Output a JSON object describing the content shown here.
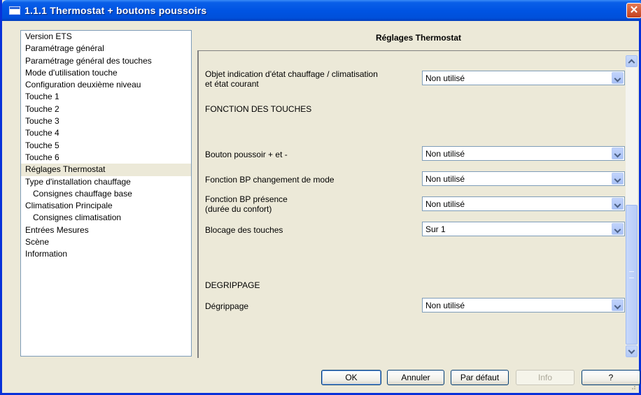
{
  "window": {
    "title": "1.1.1 Thermostat + boutons poussoirs",
    "close_label": "✕"
  },
  "nav": {
    "items": [
      {
        "label": "Version ETS"
      },
      {
        "label": "Paramétrage général"
      },
      {
        "label": "Paramétrage général des touches"
      },
      {
        "label": "Mode d'utilisation touche"
      },
      {
        "label": "Configuration deuxième niveau"
      },
      {
        "label": "Touche 1"
      },
      {
        "label": "Touche 2"
      },
      {
        "label": "Touche 3"
      },
      {
        "label": "Touche 4"
      },
      {
        "label": "Touche 5"
      },
      {
        "label": "Touche 6"
      },
      {
        "label": "Réglages Thermostat"
      },
      {
        "label": "Type d'installation chauffage"
      },
      {
        "label": "Consignes chauffage base"
      },
      {
        "label": "Climatisation Principale"
      },
      {
        "label": "Consignes climatisation"
      },
      {
        "label": "Entrées Mesures"
      },
      {
        "label": "Scène"
      },
      {
        "label": "Information"
      }
    ]
  },
  "main": {
    "title": "Réglages Thermostat",
    "rows": [
      {
        "label_line1": "Objet indication d'état chauffage / climatisation",
        "label_line2": "et état courant",
        "value": "Non utilisé"
      },
      {
        "label_line1": "Bouton poussoir + et -",
        "label_line2": "",
        "value": "Non utilisé"
      },
      {
        "label_line1": "Fonction BP changement de mode",
        "label_line2": "",
        "value": "Non utilisé"
      },
      {
        "label_line1": "Fonction BP présence",
        "label_line2": "(durée du confort)",
        "value": "Non utilisé"
      },
      {
        "label_line1": "Blocage des touches",
        "label_line2": "",
        "value": "Sur 1"
      },
      {
        "label_line1": "Dégrippage",
        "label_line2": "",
        "value": "Non utilisé"
      }
    ],
    "sections": {
      "fonction_touches": "FONCTION DES TOUCHES",
      "degrippage": "DEGRIPPAGE"
    }
  },
  "buttons": {
    "ok": "OK",
    "annuler": "Annuler",
    "par_defaut": "Par défaut",
    "info": "Info",
    "help": "?"
  },
  "colors": {
    "titlebar": "#0054e3",
    "window_bg": "#ece9d8",
    "selection_bg": "#ece9d8"
  }
}
